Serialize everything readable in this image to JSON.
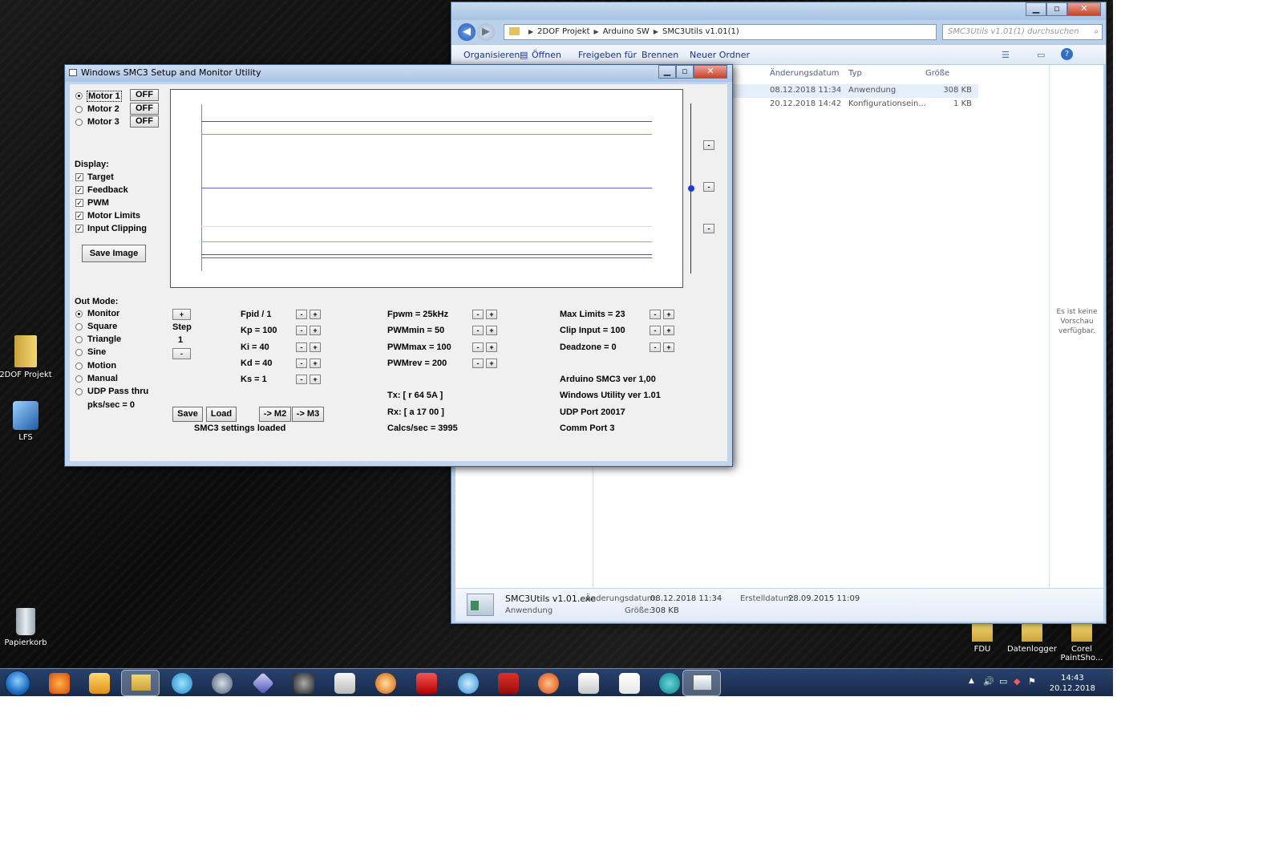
{
  "desktop": {
    "icons": [
      {
        "label": "2DOF Projekt"
      },
      {
        "label": "LFS"
      },
      {
        "label": "Papierkorb"
      },
      {
        "label": "FDU"
      },
      {
        "label": "Datenlogger"
      },
      {
        "label": "Corel PaintSho..."
      }
    ]
  },
  "explorer": {
    "breadcrumb": [
      "2DOF Projekt",
      "Arduino SW",
      "SMC3Utils v1.01(1)"
    ],
    "search_placeholder": "SMC3Utils v1.01(1) durchsuchen",
    "toolbar": [
      "Organisieren",
      "Öffnen",
      "Freigeben für",
      "Brennen",
      "Neuer Ordner"
    ],
    "columns": [
      "Änderungsdatum",
      "Typ",
      "Größe"
    ],
    "rows": [
      {
        "date": "08.12.2018 11:34",
        "type": "Anwendung",
        "size": "308 KB"
      },
      {
        "date": "20.12.2018 14:42",
        "type": "Konfigurationsein...",
        "size": "1 KB"
      }
    ],
    "preview_text": "Es ist keine Vorschau verfügbar.",
    "details": {
      "filename": "SMC3Utils v1.01.exe",
      "filetype": "Anwendung",
      "modified_label": "Änderungsdatum:",
      "modified_value": "08.12.2018 11:34",
      "size_label": "Größe:",
      "size_value": "308 KB",
      "created_label": "Erstelldatum:",
      "created_value": "28.09.2015 11:09"
    }
  },
  "smc": {
    "title": "Windows SMC3 Setup and Monitor Utility",
    "motors": [
      {
        "label": "Motor 1",
        "state": "OFF",
        "selected": true
      },
      {
        "label": "Motor 2",
        "state": "OFF",
        "selected": false
      },
      {
        "label": "Motor 3",
        "state": "OFF",
        "selected": false
      }
    ],
    "display_label": "Display:",
    "display_options": [
      "Target",
      "Feedback",
      "PWM",
      "Motor Limits",
      "Input Clipping"
    ],
    "save_image": "Save Image",
    "out_mode_label": "Out Mode:",
    "out_modes": [
      "Monitor",
      "Square",
      "Triangle",
      "Sine",
      "Motion",
      "Manual",
      "UDP Pass thru"
    ],
    "pks": "pks/sec = 0",
    "step_label": "Step",
    "step_value": "1",
    "plus": "+",
    "minus": "-",
    "pid": [
      "Fpid / 1",
      "Kp = 100",
      "Ki = 40",
      "Kd = 40",
      "Ks = 1"
    ],
    "pwm": [
      "Fpwm = 25kHz",
      "PWMmin = 50",
      "PWMmax = 100",
      "PWMrev = 200"
    ],
    "limits": [
      "Max Limits = 23",
      "Clip Input = 100",
      "Deadzone = 0"
    ],
    "buttons": {
      "save": "Save",
      "load": "Load",
      "to_m2": "-> M2",
      "to_m3": "-> M3"
    },
    "status": "SMC3 settings loaded",
    "tx": "Tx: [ r 64 5A ]",
    "rx": "Rx: [ a 17 00 ]",
    "calcs": "Calcs/sec = 3995",
    "info": [
      "Arduino SMC3 ver 1,00",
      "Windows Utility ver 1.01",
      "UDP Port 20017",
      "Comm Port 3"
    ],
    "plot_lines": [
      {
        "color": "#a0355a",
        "level": 0.9
      },
      {
        "color": "#c8961e",
        "level": 0.82
      },
      {
        "color": "#6464c8",
        "level": 0.5
      },
      {
        "color": "#dcdcdc",
        "level": 0.27
      },
      {
        "color": "#e6964b",
        "level": 0.18
      },
      {
        "color": "#a0355a",
        "level": 0.1
      },
      {
        "color": "#2a9a2a",
        "level": 0.08
      }
    ]
  },
  "taskbar": {
    "time": "14:43",
    "date": "20.12.2018"
  }
}
